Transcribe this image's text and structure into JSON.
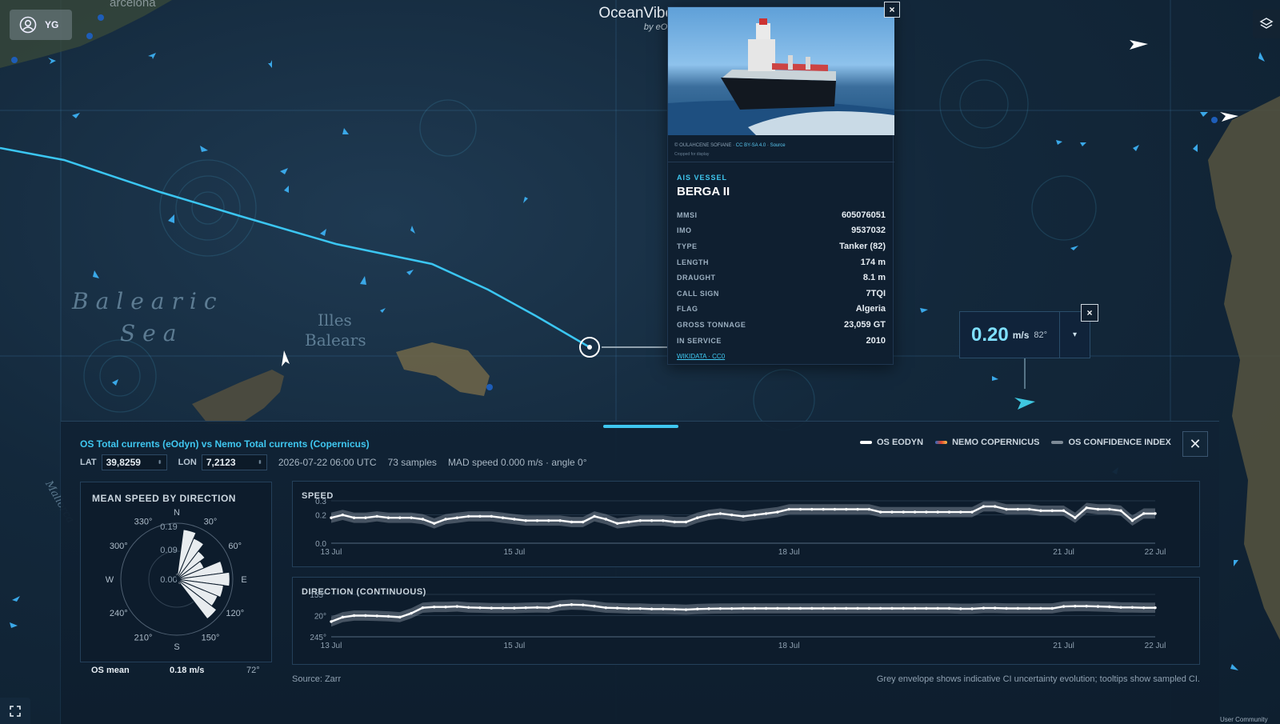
{
  "map": {
    "places": [
      "Balearic",
      "Sea",
      "Illes",
      "Balears",
      "Mallorca"
    ],
    "city_partial": "arcelona"
  },
  "user": {
    "initials": "YG"
  },
  "brand": {
    "title": "OceanVibes",
    "subtitle": "by eOdyn"
  },
  "vessel": {
    "photo_credit": "© OULAHCENE SOFIANE ·",
    "photo_license": "CC BY-SA 4.0",
    "photo_source": "Source",
    "photo_note": "Cropped for display",
    "tag": "AIS VESSEL",
    "name": "BERGA II",
    "fields": [
      {
        "k": "MMSI",
        "v": "605076051"
      },
      {
        "k": "IMO",
        "v": "9537032"
      },
      {
        "k": "TYPE",
        "v": "Tanker (82)"
      },
      {
        "k": "LENGTH",
        "v": "174 m"
      },
      {
        "k": "DRAUGHT",
        "v": "8.1 m"
      },
      {
        "k": "CALL SIGN",
        "v": "7TQI"
      },
      {
        "k": "FLAG",
        "v": "Algeria"
      },
      {
        "k": "GROSS TONNAGE",
        "v": "23,059 GT"
      },
      {
        "k": "IN SERVICE",
        "v": "2010"
      }
    ],
    "wiki": "WIKIDATA · CC0",
    "close": "×"
  },
  "probe": {
    "value": "0.20",
    "unit": "m/s",
    "direction": "82°",
    "dropdown": "▾",
    "close": "×"
  },
  "panel": {
    "title": "OS Total currents (eOdyn) vs Nemo Total currents (Copernicus)",
    "legend": [
      {
        "label": "OS EODYN",
        "color": "#ffffff"
      },
      {
        "label": "NEMO COPERNICUS",
        "color": "#e0442c"
      },
      {
        "label": "OS CONFIDENCE INDEX",
        "color": "#7d8a96"
      }
    ],
    "close": "✕",
    "lat_label": "LAT",
    "lat_value": "39,8259",
    "lon_label": "LON",
    "lon_value": "7,2123",
    "timestamp": "2026-07-22 06:00 UTC",
    "samples": "73 samples",
    "mad": "MAD speed 0.000 m/s · angle 0°",
    "rose_title": "MEAN SPEED BY DIRECTION",
    "rose_footer_label": "OS mean",
    "rose_footer_speed": "0.18 m/s",
    "rose_footer_dir": "72°",
    "source": "Source: Zarr",
    "ci_note": "Grey envelope shows indicative CI uncertainty evolution; tooltips show sampled CI."
  },
  "chart_data": [
    {
      "type": "line",
      "title": "SPEED",
      "x_tick_labels": [
        "13 Jul",
        "15 Jul",
        "18 Jul",
        "21 Jul",
        "22 Jul"
      ],
      "x_tick_days": [
        13,
        15,
        18,
        21,
        22
      ],
      "xlim": [
        13,
        22
      ],
      "ylim": [
        0,
        0.3
      ],
      "y_ticks": [
        "0.3",
        "0.2",
        "0.0"
      ],
      "y_tick_values": [
        0.3,
        0.2,
        0.0
      ],
      "series": [
        {
          "name": "OS EODYN",
          "x_days": [
            13.0,
            13.125,
            13.25,
            13.375,
            13.5,
            13.625,
            13.75,
            13.875,
            14.0,
            14.125,
            14.25,
            14.375,
            14.5,
            14.625,
            14.75,
            14.875,
            15.0,
            15.125,
            15.25,
            15.375,
            15.5,
            15.625,
            15.75,
            15.875,
            16.0,
            16.125,
            16.25,
            16.375,
            16.5,
            16.625,
            16.75,
            16.875,
            17.0,
            17.125,
            17.25,
            17.375,
            17.5,
            17.625,
            17.75,
            17.875,
            18.0,
            18.125,
            18.25,
            18.375,
            18.5,
            18.625,
            18.75,
            18.875,
            19.0,
            19.125,
            19.25,
            19.375,
            19.5,
            19.625,
            19.75,
            19.875,
            20.0,
            20.125,
            20.25,
            20.375,
            20.5,
            20.625,
            20.75,
            20.875,
            21.0,
            21.125,
            21.25,
            21.375,
            21.5,
            21.625,
            21.75,
            21.875,
            22.0
          ],
          "values": [
            0.18,
            0.2,
            0.18,
            0.18,
            0.19,
            0.18,
            0.18,
            0.18,
            0.17,
            0.14,
            0.17,
            0.18,
            0.19,
            0.19,
            0.19,
            0.18,
            0.17,
            0.16,
            0.16,
            0.16,
            0.16,
            0.15,
            0.15,
            0.19,
            0.17,
            0.14,
            0.15,
            0.16,
            0.16,
            0.16,
            0.15,
            0.15,
            0.18,
            0.2,
            0.21,
            0.2,
            0.19,
            0.2,
            0.21,
            0.22,
            0.24,
            0.24,
            0.24,
            0.24,
            0.24,
            0.24,
            0.24,
            0.24,
            0.22,
            0.22,
            0.22,
            0.22,
            0.22,
            0.22,
            0.22,
            0.22,
            0.22,
            0.26,
            0.26,
            0.24,
            0.24,
            0.24,
            0.23,
            0.23,
            0.23,
            0.18,
            0.25,
            0.24,
            0.24,
            0.23,
            0.16,
            0.21,
            0.21
          ]
        }
      ]
    },
    {
      "type": "line",
      "title": "DIRECTION (CONTINUOUS)",
      "x_tick_labels": [
        "13 Jul",
        "15 Jul",
        "18 Jul",
        "21 Jul",
        "22 Jul"
      ],
      "x_tick_days": [
        13,
        15,
        18,
        21,
        22
      ],
      "xlim": [
        13,
        22
      ],
      "y_ticks": [
        "155°",
        "20°",
        "245°"
      ],
      "y_tick_values": [
        155,
        20,
        -115
      ],
      "ylim": [
        -115,
        155
      ],
      "series": [
        {
          "name": "OS EODYN",
          "x_days": [
            13.0,
            13.125,
            13.25,
            13.375,
            13.5,
            13.625,
            13.75,
            13.875,
            14.0,
            14.125,
            14.25,
            14.375,
            14.5,
            14.625,
            14.75,
            14.875,
            15.0,
            15.125,
            15.25,
            15.375,
            15.5,
            15.625,
            15.75,
            15.875,
            16.0,
            16.125,
            16.25,
            16.375,
            16.5,
            16.625,
            16.75,
            16.875,
            17.0,
            17.125,
            17.25,
            17.375,
            17.5,
            17.625,
            17.75,
            17.875,
            18.0,
            18.125,
            18.25,
            18.375,
            18.5,
            18.625,
            18.75,
            18.875,
            19.0,
            19.125,
            19.25,
            19.375,
            19.5,
            19.625,
            19.75,
            19.875,
            20.0,
            20.125,
            20.25,
            20.375,
            20.5,
            20.625,
            20.75,
            20.875,
            21.0,
            21.125,
            21.25,
            21.375,
            21.5,
            21.625,
            21.75,
            21.875,
            22.0
          ],
          "values": [
            -18,
            10,
            20,
            20,
            18,
            15,
            10,
            35,
            70,
            75,
            75,
            78,
            72,
            70,
            68,
            68,
            68,
            70,
            72,
            70,
            85,
            90,
            88,
            80,
            70,
            68,
            65,
            65,
            62,
            62,
            60,
            58,
            62,
            64,
            65,
            65,
            66,
            66,
            66,
            66,
            66,
            66,
            66,
            66,
            66,
            66,
            66,
            66,
            66,
            66,
            66,
            66,
            66,
            66,
            66,
            64,
            64,
            68,
            68,
            66,
            66,
            66,
            66,
            66,
            78,
            80,
            80,
            78,
            76,
            72,
            72,
            70,
            70
          ]
        }
      ]
    },
    {
      "type": "bar",
      "title": "MEAN SPEED BY DIRECTION",
      "polar": true,
      "r_ticks": [
        "0.19",
        "0.09",
        "0.00"
      ],
      "angle_labels": [
        "N",
        "30°",
        "60°",
        "E",
        "120°",
        "150°",
        "S",
        "210°",
        "240°",
        "W",
        "300°",
        "330°"
      ],
      "categories_deg": [
        0,
        15,
        30,
        45,
        60,
        75,
        90,
        105,
        120,
        135,
        150
      ],
      "values": [
        0.02,
        0.17,
        0.15,
        0.12,
        0.1,
        0.16,
        0.18,
        0.16,
        0.15,
        0.17,
        0.02
      ]
    }
  ]
}
